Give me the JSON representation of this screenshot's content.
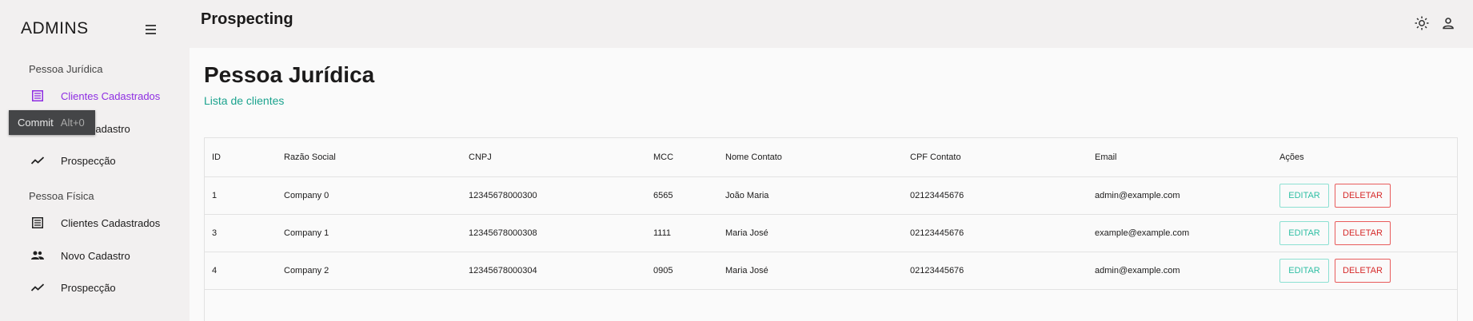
{
  "sidebar": {
    "brand": "ADMINS",
    "sections": [
      {
        "label": "Pessoa Jurídica",
        "items": [
          {
            "label": "Clientes Cadastrados",
            "icon": "list-icon"
          },
          {
            "label": "Novo Cadastro",
            "icon": "users-icon"
          },
          {
            "label": "Prospecção",
            "icon": "trending-icon"
          }
        ]
      },
      {
        "label": "Pessoa Física",
        "items": [
          {
            "label": "Clientes Cadastrados",
            "icon": "list-icon"
          },
          {
            "label": "Novo Cadastro",
            "icon": "users-icon"
          },
          {
            "label": "Prospecção",
            "icon": "trending-icon"
          }
        ]
      }
    ],
    "active_color": "#8e2de2"
  },
  "tooltip": {
    "label": "Commit",
    "shortcut": "Alt+0"
  },
  "header": {
    "title": "Prospecting",
    "icons": [
      "theme-sun-icon",
      "account-icon"
    ]
  },
  "main": {
    "title": "Pessoa Jurídica",
    "subtitle": "Lista de clientes",
    "subtitle_color": "#1ba38e"
  },
  "table": {
    "columns": [
      "ID",
      "Razão Social",
      "CNPJ",
      "MCC",
      "Nome Contato",
      "CPF Contato",
      "Email",
      "Ações"
    ],
    "rows": [
      {
        "id": "1",
        "razao": "Company 0",
        "cnpj": "12345678000300",
        "mcc": "6565",
        "nome": "João Maria",
        "cpf": "02123445676",
        "email": "admin@example.com"
      },
      {
        "id": "3",
        "razao": "Company 1",
        "cnpj": "12345678000308",
        "mcc": "1111",
        "nome": "Maria José",
        "cpf": "02123445676",
        "email": "example@example.com"
      },
      {
        "id": "4",
        "razao": "Company 2",
        "cnpj": "12345678000304",
        "mcc": "0905",
        "nome": "Maria José",
        "cpf": "02123445676",
        "email": "admin@example.com"
      }
    ],
    "edit_label": "EDITAR",
    "delete_label": "DELETAR",
    "edit_color": "#2fbfa4",
    "delete_color": "#d62a2a"
  }
}
